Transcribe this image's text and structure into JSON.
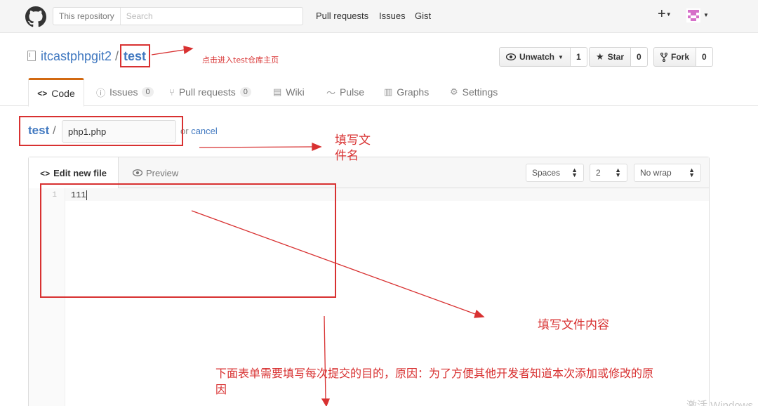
{
  "header": {
    "search_scope": "This repository",
    "search_placeholder": "Search",
    "nav": [
      "Pull requests",
      "Issues",
      "Gist"
    ],
    "plus_label": "+"
  },
  "repo": {
    "owner": "itcastphpgit2",
    "separator": "/",
    "name": "test",
    "unwatch_label": "Unwatch",
    "unwatch_count": "1",
    "star_label": "Star",
    "star_count": "0",
    "fork_label": "Fork",
    "fork_count": "0"
  },
  "tabs": {
    "code": "Code",
    "issues": "Issues",
    "issues_count": "0",
    "pulls": "Pull requests",
    "pulls_count": "0",
    "wiki": "Wiki",
    "pulse": "Pulse",
    "graphs": "Graphs",
    "settings": "Settings"
  },
  "file": {
    "crumb": "test",
    "separator": "/",
    "filename": "php1.php",
    "or_text": "or",
    "cancel_label": "cancel"
  },
  "editor": {
    "edit_tab": "Edit new file",
    "preview_tab": "Preview",
    "indent_mode": "Spaces",
    "indent_size": "2",
    "wrap_mode": "No wrap",
    "line_number": "1",
    "content": "111"
  },
  "annotations": {
    "repo_home": "点击进入test仓库主页",
    "filename_line1": "填写文",
    "filename_line2": "件名",
    "content": "填写文件内容",
    "commit_line1": "下面表单需要填写每次提交的目的，原因：为了方便其他开发者知道本次添加或修改的原",
    "commit_line2": "因"
  },
  "watermark": "激活 Windows",
  "colors": {
    "link": "#4078c0",
    "annotation": "#d83131",
    "active_tab_accent": "#d26911"
  }
}
